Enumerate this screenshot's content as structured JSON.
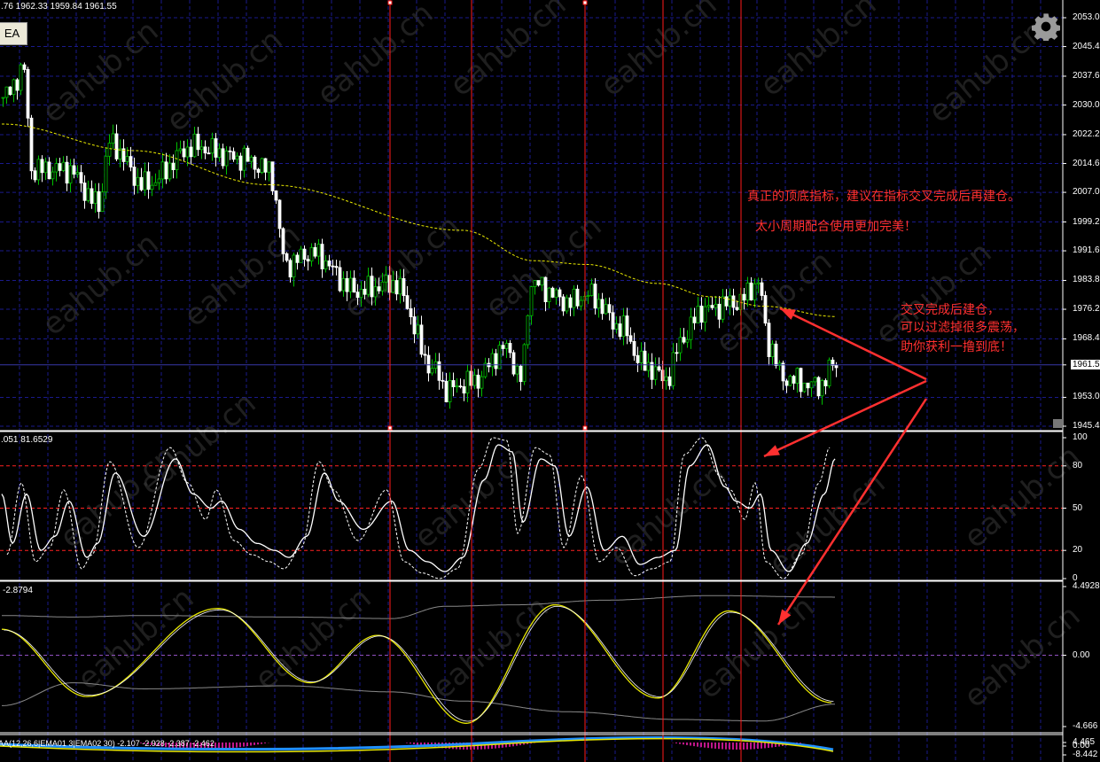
{
  "header": {
    "ohlc_text": ".76 1962.33 1959.84 1961.55",
    "ea_button": "EA"
  },
  "watermark": "eahub.cn",
  "annotations": {
    "line1": "真正的顶底指标，建议在指标交叉完成后再建仓。",
    "line2": "太小周期配合使用更加完美！",
    "side1": "交叉完成后建仓，",
    "side2": "可以过滤掉很多震荡，",
    "side3": "助你获利一撸到底！"
  },
  "colors": {
    "bull": "#00c000",
    "bear": "#ffffff",
    "ma": "#e8e800",
    "grid": "#1a1a8c",
    "marker": "#ff1a1a",
    "level": "#ff2020"
  },
  "chart_data": [
    {
      "type": "candlestick",
      "title": "Price",
      "current_price": "1961.5",
      "ylim": [
        1945.4,
        2053.0
      ],
      "y_ticks": [
        "2053.0",
        "2045.4",
        "2037.6",
        "2030.0",
        "2022.2",
        "2014.6",
        "2007.0",
        "1999.2",
        "1991.6",
        "1983.8",
        "1976.2",
        "1968.4",
        "1953.0",
        "1945.4"
      ],
      "close_waypoints": [
        [
          0,
          2032
        ],
        [
          6,
          2039
        ],
        [
          8,
          2013
        ],
        [
          18,
          2013
        ],
        [
          27,
          2004
        ],
        [
          30,
          2020
        ],
        [
          40,
          2009
        ],
        [
          54,
          2019
        ],
        [
          67,
          2016
        ],
        [
          75,
          2013
        ],
        [
          80,
          1988
        ],
        [
          87,
          1991
        ],
        [
          100,
          1981
        ],
        [
          110,
          1983
        ],
        [
          122,
          1960
        ],
        [
          125,
          1955
        ],
        [
          132,
          1957
        ],
        [
          142,
          1966
        ],
        [
          146,
          1958
        ],
        [
          149,
          1983
        ],
        [
          160,
          1978
        ],
        [
          165,
          1980
        ],
        [
          175,
          1971
        ],
        [
          180,
          1962
        ],
        [
          187,
          1958
        ],
        [
          192,
          1969
        ],
        [
          197,
          1976
        ],
        [
          207,
          1978
        ],
        [
          213,
          1983
        ],
        [
          216,
          1967
        ],
        [
          220,
          1958
        ],
        [
          230,
          1956
        ],
        [
          235,
          1962
        ]
      ],
      "ma_waypoints": [
        [
          0,
          2025
        ],
        [
          37,
          2018
        ],
        [
          75,
          2009
        ],
        [
          130,
          1997
        ],
        [
          150,
          1989
        ],
        [
          165,
          1988
        ],
        [
          185,
          1983
        ],
        [
          200,
          1979.5
        ],
        [
          215,
          1977
        ],
        [
          235,
          1974.3
        ]
      ],
      "event_bars": [
        109,
        132,
        164,
        186,
        208
      ]
    },
    {
      "type": "line",
      "title": "Stochastic",
      "header_values": ".051 81.6529",
      "ylim": [
        0,
        100
      ],
      "y_ticks": [
        "100",
        "80",
        "50",
        "20",
        "0"
      ],
      "levels": [
        80,
        50,
        20
      ],
      "main": [
        [
          0,
          60
        ],
        [
          3,
          25
        ],
        [
          7,
          60
        ],
        [
          11,
          20
        ],
        [
          15,
          30
        ],
        [
          19,
          55
        ],
        [
          24,
          15
        ],
        [
          27,
          25
        ],
        [
          32,
          75
        ],
        [
          40,
          30
        ],
        [
          49,
          85
        ],
        [
          54,
          60
        ],
        [
          59,
          50
        ],
        [
          62,
          55
        ],
        [
          67,
          35
        ],
        [
          72,
          25
        ],
        [
          77,
          20
        ],
        [
          81,
          15
        ],
        [
          86,
          30
        ],
        [
          91,
          75
        ],
        [
          95,
          55
        ],
        [
          102,
          35
        ],
        [
          110,
          55
        ],
        [
          115,
          20
        ],
        [
          120,
          12
        ],
        [
          125,
          5
        ],
        [
          130,
          15
        ],
        [
          136,
          70
        ],
        [
          140,
          95
        ],
        [
          144,
          90
        ],
        [
          147,
          40
        ],
        [
          152,
          85
        ],
        [
          156,
          80
        ],
        [
          160,
          30
        ],
        [
          165,
          65
        ],
        [
          170,
          20
        ],
        [
          175,
          30
        ],
        [
          180,
          10
        ],
        [
          185,
          15
        ],
        [
          190,
          20
        ],
        [
          194,
          80
        ],
        [
          199,
          95
        ],
        [
          204,
          65
        ],
        [
          207,
          55
        ],
        [
          211,
          50
        ],
        [
          214,
          60
        ],
        [
          217,
          20
        ],
        [
          222,
          5
        ],
        [
          227,
          25
        ],
        [
          232,
          60
        ],
        [
          235,
          85
        ]
      ]
    },
    {
      "type": "line",
      "title": "Oscillator",
      "header_values": "-2.8794",
      "ylim": [
        -4.666,
        4.4928
      ],
      "y_ticks": [
        "4.4928",
        "0.00",
        "-4.666"
      ],
      "signal": [
        [
          0,
          1.7
        ],
        [
          24,
          -2.7
        ],
        [
          61,
          3.06
        ],
        [
          87,
          -1.8
        ],
        [
          106,
          1.3
        ],
        [
          131,
          -4.45
        ],
        [
          156,
          3.3
        ],
        [
          185,
          -2.8
        ],
        [
          205,
          2.9
        ],
        [
          234,
          -3.1
        ]
      ],
      "upper_band": [
        [
          0,
          2.6
        ],
        [
          20,
          2.5
        ],
        [
          40,
          2.6
        ],
        [
          80,
          2.5
        ],
        [
          110,
          2.4
        ],
        [
          125,
          3.2
        ],
        [
          145,
          3.3
        ],
        [
          170,
          3.6
        ],
        [
          200,
          3.9
        ],
        [
          235,
          3.8
        ]
      ],
      "lower_band": [
        [
          0,
          -3.3
        ],
        [
          20,
          -1.8
        ],
        [
          40,
          -2.2
        ],
        [
          80,
          -2.0
        ],
        [
          110,
          -2.4
        ],
        [
          130,
          -3.0
        ],
        [
          160,
          -3.7
        ],
        [
          190,
          -4.2
        ],
        [
          215,
          -4.3
        ],
        [
          235,
          -3.2
        ]
      ]
    },
    {
      "type": "bar",
      "title": "MACD",
      "header_values": "AA(12,26,6|EMA01 3|EMA02 30) -2.107 -2.928 -2.387 -2.462",
      "y_ticks": [
        "4.465",
        "0.00",
        "-8.442"
      ]
    }
  ]
}
